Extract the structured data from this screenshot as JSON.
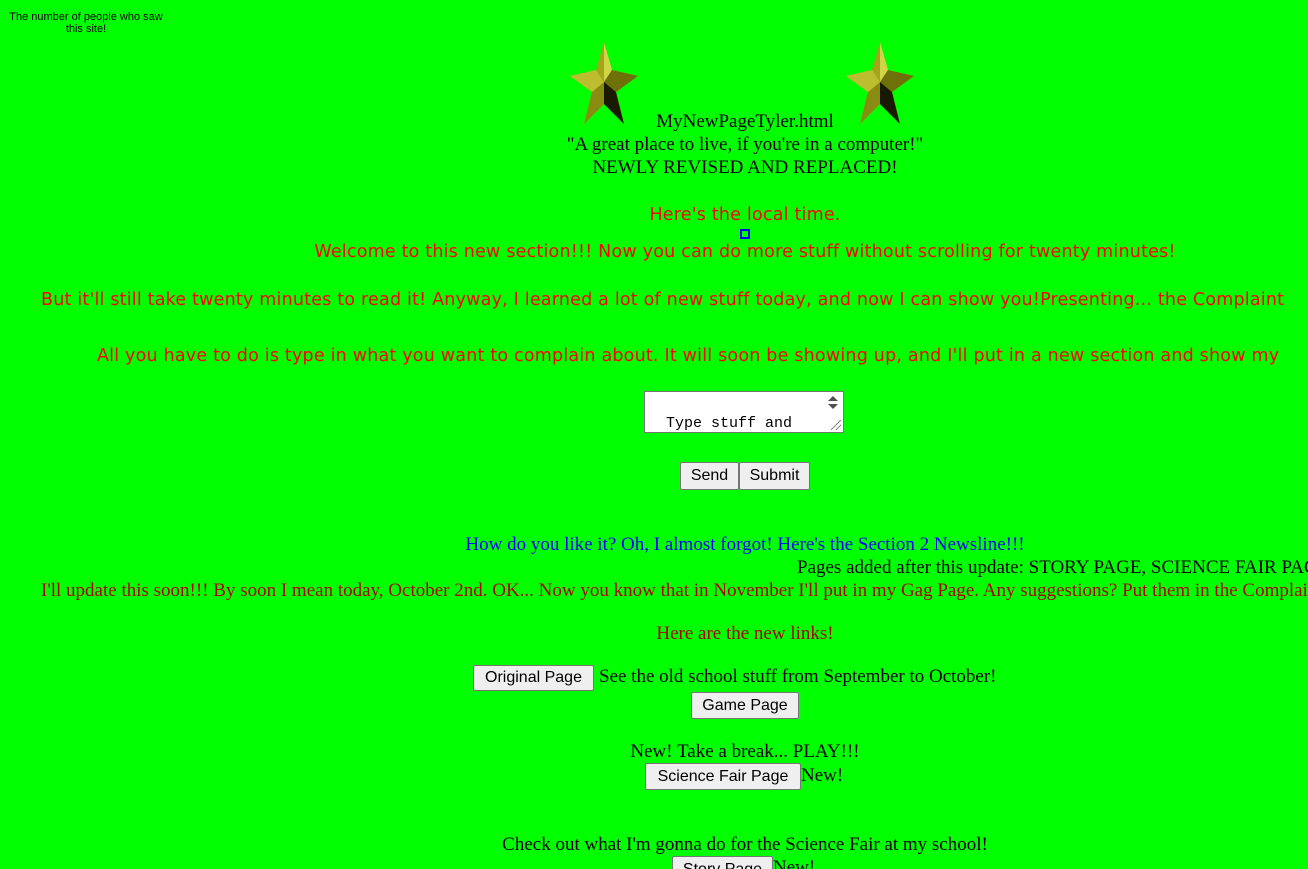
{
  "counter": {
    "label": "The number of people who saw this site!"
  },
  "header": {
    "filename": "MyNewPageTyler.html",
    "tagline": "\"A great place to live, if you're in a computer!\"",
    "revised": "NEWLY REVISED AND REPLACED!"
  },
  "icons": {
    "left_star": "star-icon",
    "right_star": "star-icon"
  },
  "colors": {
    "background": "#00ff00",
    "red_text": "#ff0000",
    "blue_text": "#0000ff",
    "maroon_text": "#b00000"
  },
  "intro": {
    "local_time": "Here's the local time.",
    "welcome": "Welcome to this new section!!! Now you can do more stuff without scrolling for twenty minutes!",
    "still_read": "But it'll still take twenty minutes to read it! Anyway, I learned a lot of new stuff today, and now I can show you!Presenting... the Complaint",
    "instructions": "All you have to do is type in what you want to complain about. It will soon be showing up, and I'll put in a new section and show my"
  },
  "complaint_form": {
    "textarea_value": "Type stuff and send it to my E-mail!",
    "send_label": "Send",
    "submit_label": "Submit"
  },
  "newsline": {
    "question": "How do you like it? Oh, I almost forgot! Here's the Section 2 Newsline!!!",
    "pages_added": "Pages added after this update: STORY PAGE, SCIENCE FAIR PAGE",
    "update_note": "I'll update this soon!!! By soon I mean today, October 2nd. OK... Now you know that in November I'll put in my Gag Page. Any suggestions? Put them in the Complaint box!",
    "new_links": "Here are the new links!"
  },
  "links": {
    "original_page_label": "Original Page",
    "original_page_desc": "See the old school stuff from September to October!",
    "game_page_label": "Game Page",
    "game_page_desc": "New! Take a break... PLAY!!!",
    "science_fair_label": "Science Fair Page",
    "science_fair_new": "New!",
    "science_fair_desc": "Check out what I'm gonna do for the Science Fair at my school!",
    "story_page_label": "Story Page",
    "story_page_new": "New!"
  }
}
